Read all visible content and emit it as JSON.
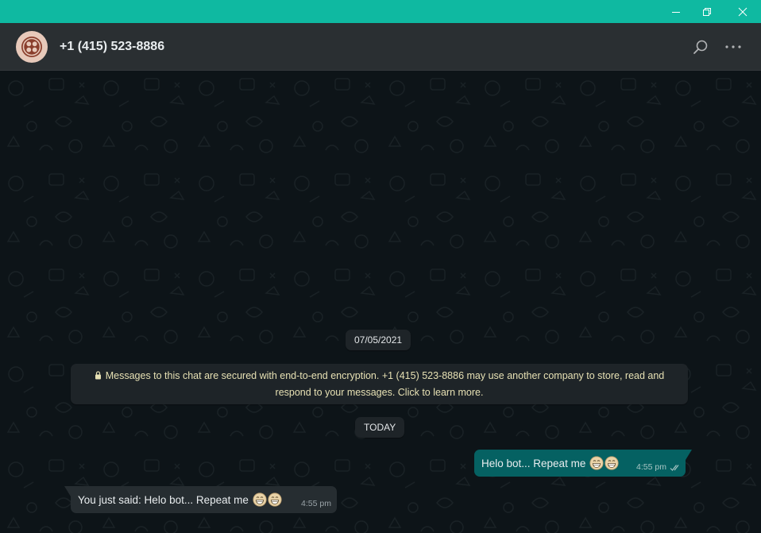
{
  "window": {
    "accent_color": "#0fb9a1",
    "controls": [
      "minimize-icon",
      "restore-icon",
      "close-icon"
    ]
  },
  "header": {
    "contact_name": "+1 (415) 523-8886",
    "avatar_color": "#e7c9ba",
    "icons": [
      "search-icon",
      "more-options-icon"
    ]
  },
  "chat": {
    "date_pill": "07/05/2021",
    "encryption_notice": {
      "icon": "lock-icon",
      "line1": "Messages to this chat are secured with end-to-end encryption. +1 (415) 523-8886 may use another company to store, read and",
      "line2": "respond to your messages. Click to learn more."
    },
    "today_pill": "TODAY",
    "messages": [
      {
        "direction": "outgoing",
        "text": "Helo bot... Repeat me",
        "emoji": [
          "grinning-face-icon",
          "grinning-face-icon"
        ],
        "time": "4:55 pm",
        "status_icon": "double-check-icon",
        "bubble_color": "#056162"
      },
      {
        "direction": "incoming",
        "text": "You just said: Helo bot... Repeat me",
        "emoji": [
          "grinning-face-icon",
          "grinning-face-icon"
        ],
        "time": "4:55 pm",
        "bubble_color": "#262d31"
      }
    ]
  }
}
